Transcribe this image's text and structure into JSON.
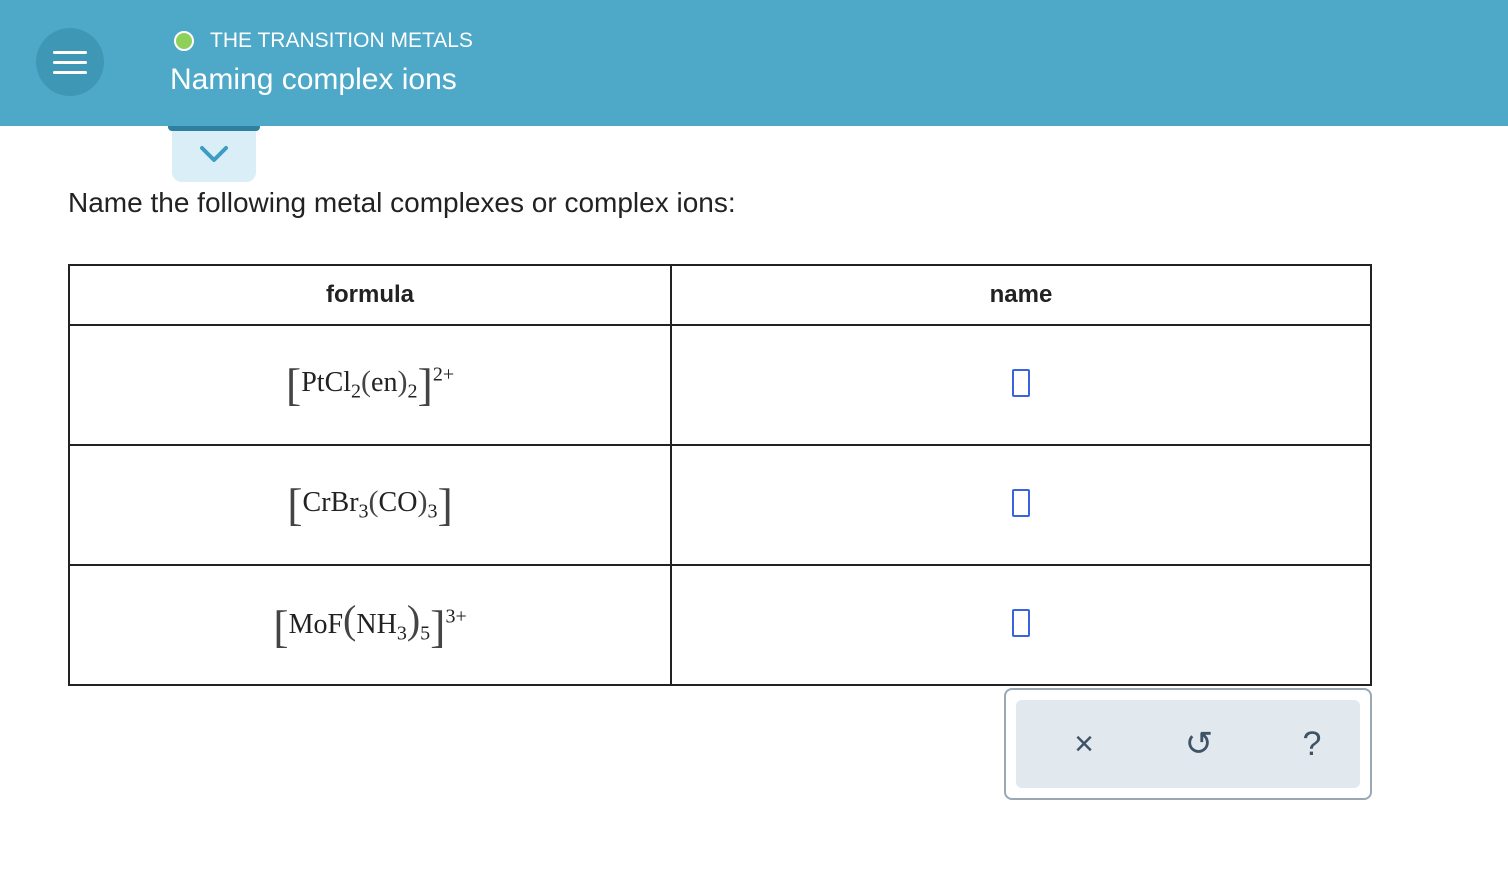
{
  "header": {
    "topic": "THE TRANSITION METALS",
    "title": "Naming complex ions"
  },
  "prompt": "Name the following metal complexes or complex ions:",
  "table": {
    "headers": [
      "formula",
      "name"
    ],
    "rows": [
      {
        "formula": {
          "metal": "PtCl",
          "metal_sub": "2",
          "ligand": "en",
          "ligand_sub": "2",
          "charge": "2+"
        }
      },
      {
        "formula": {
          "metal": "CrBr",
          "metal_sub": "3",
          "ligand": "CO",
          "ligand_sub": "3",
          "charge": ""
        }
      },
      {
        "formula": {
          "metal": "MoF",
          "metal_sub": "",
          "ligand": "NH",
          "ligand_inner_sub": "3",
          "ligand_sub": "5",
          "charge": "3+"
        }
      }
    ]
  },
  "tools": {
    "clear": "×",
    "undo": "↺",
    "help": "?"
  },
  "colors": {
    "header_bg": "#4ea9c9",
    "status_dot": "#8fd05a",
    "answer_box": "#3a63e0"
  },
  "icons": [
    "menu-icon",
    "status-dot",
    "chevron-down-icon",
    "clear-icon",
    "undo-icon",
    "help-icon"
  ]
}
